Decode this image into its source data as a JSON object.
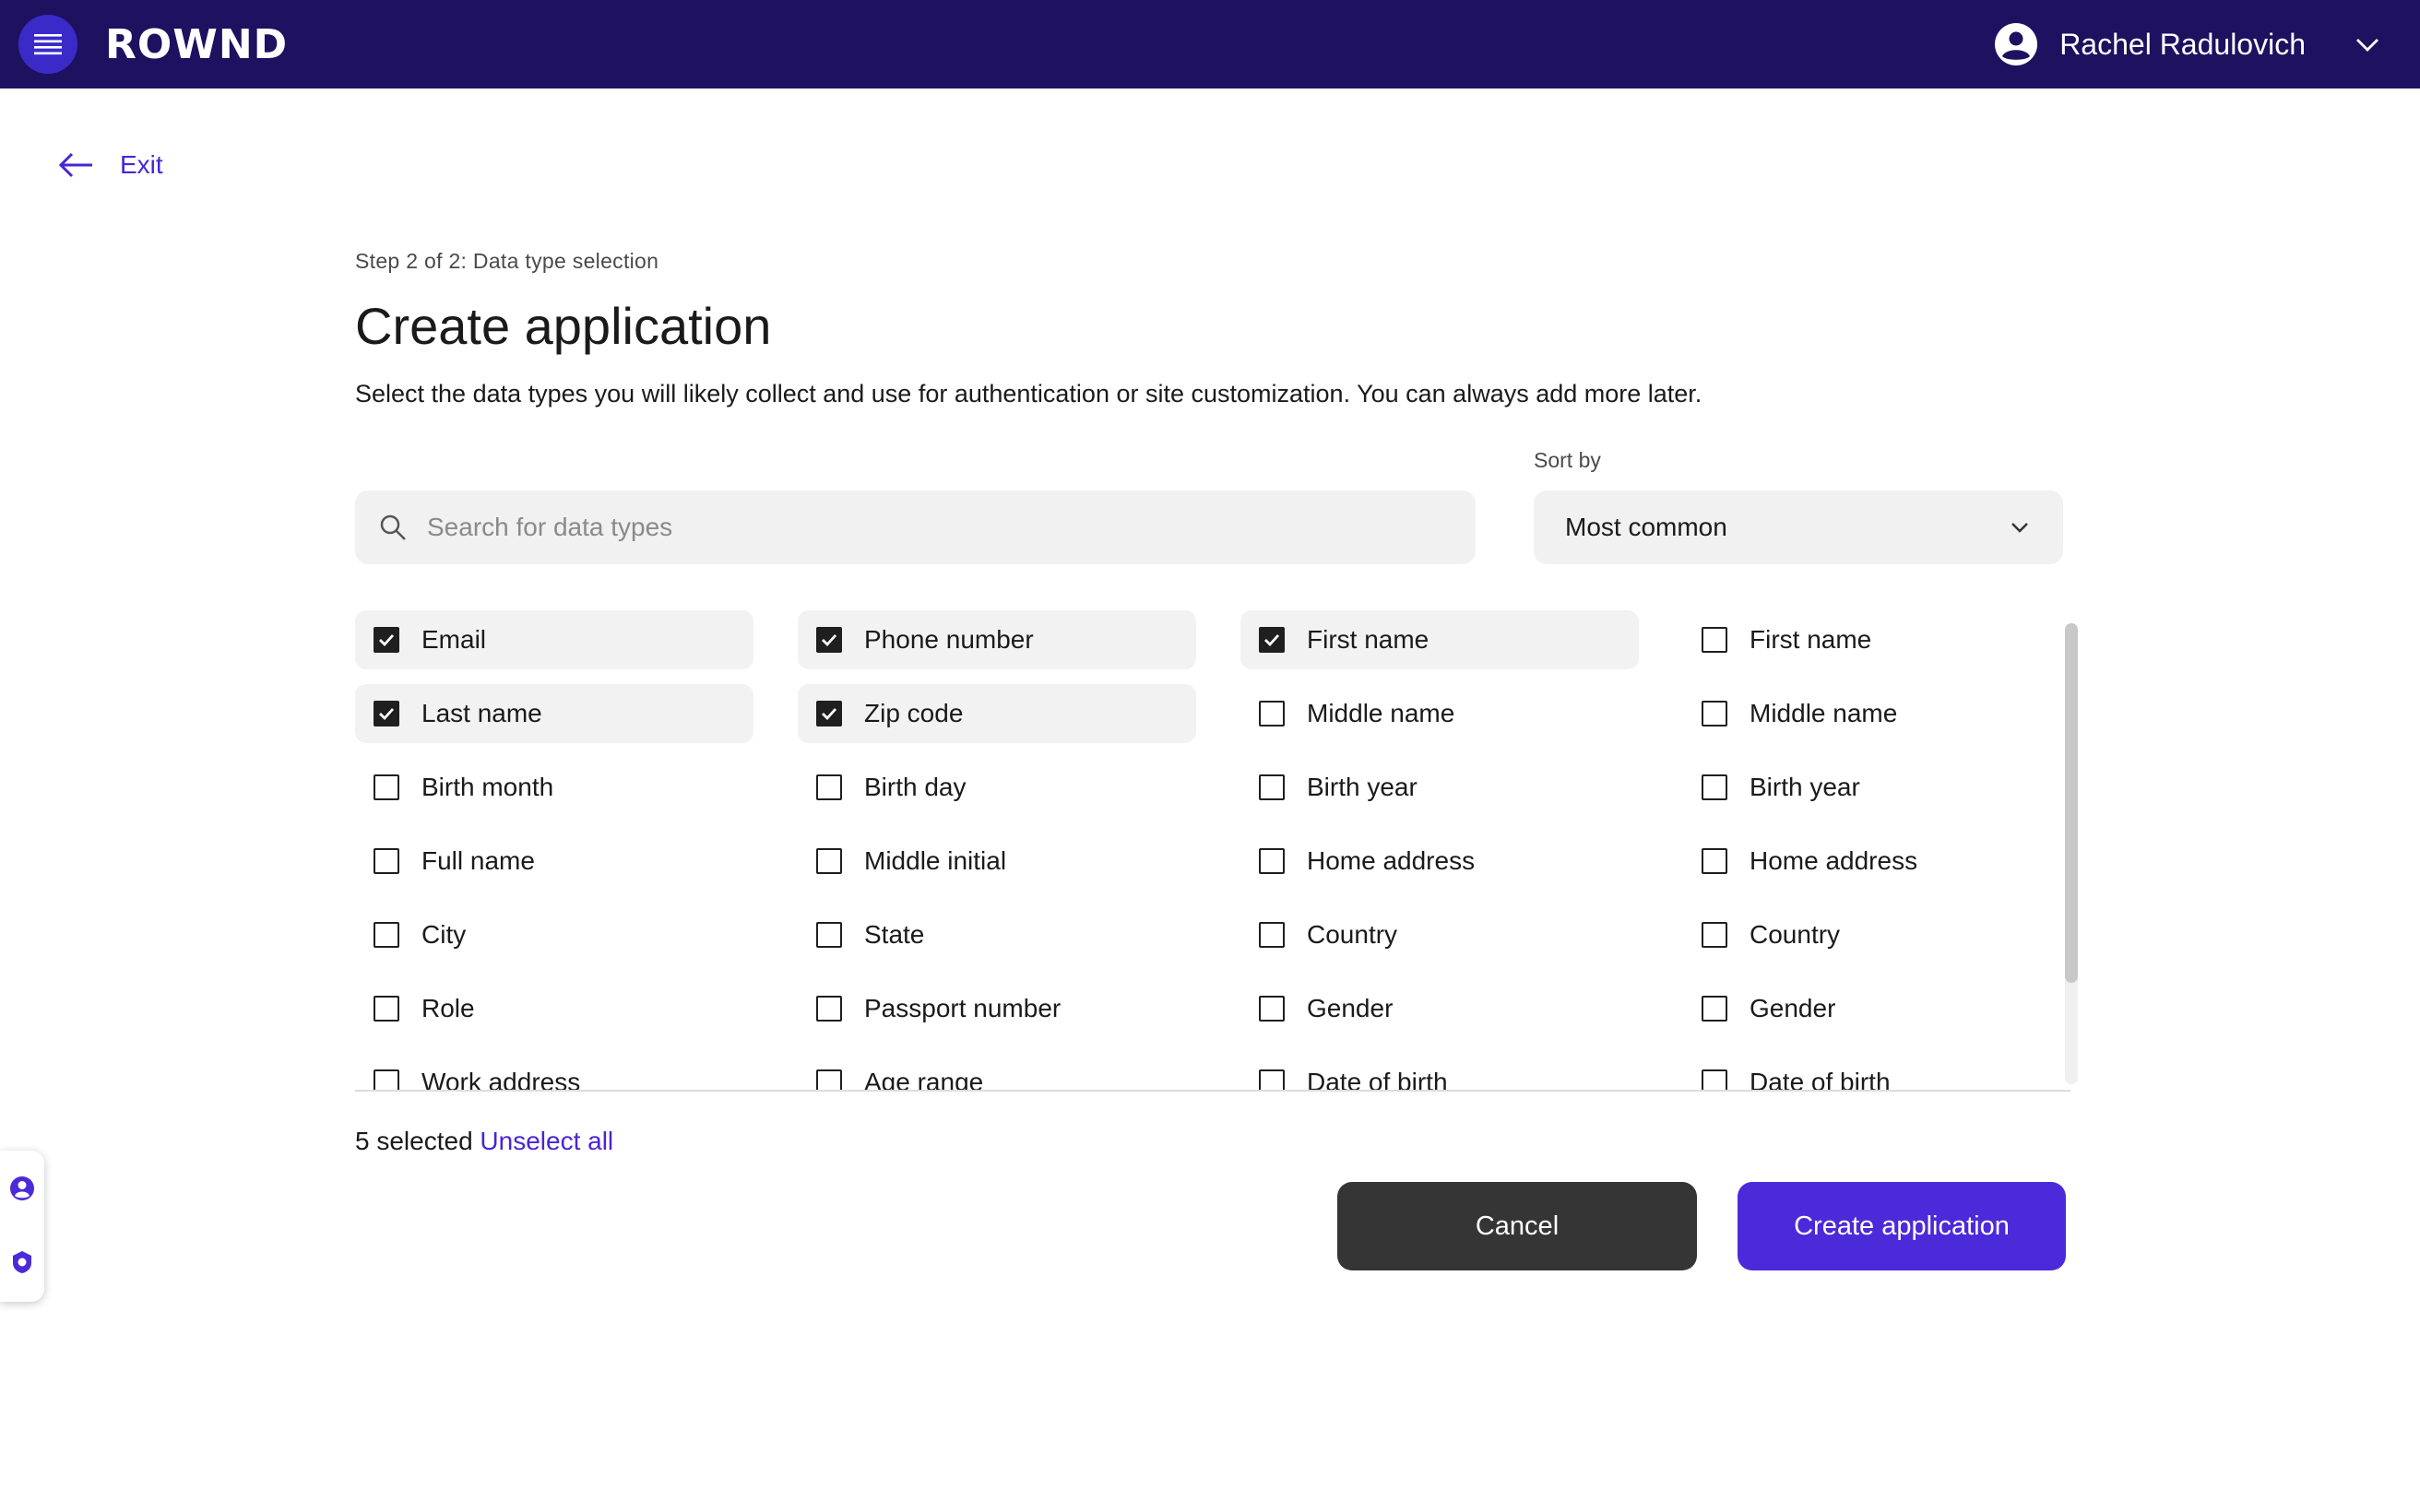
{
  "header": {
    "logo_text": "ROWND",
    "user_name": "Rachel Radulovich"
  },
  "nav": {
    "exit_label": "Exit"
  },
  "page": {
    "step": "Step 2 of 2: Data type selection",
    "title": "Create application",
    "description": "Select the data types you will likely collect and use for authentication or site customization. You can always add more later."
  },
  "search": {
    "placeholder": "Search for data types",
    "value": ""
  },
  "sort": {
    "label": "Sort by",
    "selected": "Most common"
  },
  "data_types": [
    {
      "label": "Email",
      "checked": true
    },
    {
      "label": "Phone number",
      "checked": true
    },
    {
      "label": "First name",
      "checked": true
    },
    {
      "label": "First name",
      "checked": false
    },
    {
      "label": "Last name",
      "checked": true
    },
    {
      "label": "Zip code",
      "checked": true
    },
    {
      "label": "Middle name",
      "checked": false
    },
    {
      "label": "Middle name",
      "checked": false
    },
    {
      "label": "Birth month",
      "checked": false
    },
    {
      "label": "Birth day",
      "checked": false
    },
    {
      "label": "Birth year",
      "checked": false
    },
    {
      "label": "Birth year",
      "checked": false
    },
    {
      "label": "Full name",
      "checked": false
    },
    {
      "label": "Middle initial",
      "checked": false
    },
    {
      "label": "Home address",
      "checked": false
    },
    {
      "label": "Home address",
      "checked": false
    },
    {
      "label": "City",
      "checked": false
    },
    {
      "label": "State",
      "checked": false
    },
    {
      "label": "Country",
      "checked": false
    },
    {
      "label": "Country",
      "checked": false
    },
    {
      "label": "Role",
      "checked": false
    },
    {
      "label": "Passport number",
      "checked": false
    },
    {
      "label": "Gender",
      "checked": false
    },
    {
      "label": "Gender",
      "checked": false
    },
    {
      "label": "Work address",
      "checked": false
    },
    {
      "label": "Age range",
      "checked": false
    },
    {
      "label": "Date of birth",
      "checked": false
    },
    {
      "label": "Date of birth",
      "checked": false
    }
  ],
  "selection": {
    "count_text": "5 selected",
    "unselect_label": "Unselect all"
  },
  "actions": {
    "cancel_label": "Cancel",
    "create_label": "Create application"
  },
  "colors": {
    "header_bg": "#1d1160",
    "accent": "#4b2ad9",
    "link": "#4a24d6",
    "cancel_bg": "#353535"
  },
  "icons": [
    "menu-icon",
    "user-avatar-icon",
    "chevron-down-icon",
    "arrow-left-icon",
    "search-icon",
    "checkmark-icon",
    "shield-icon"
  ]
}
